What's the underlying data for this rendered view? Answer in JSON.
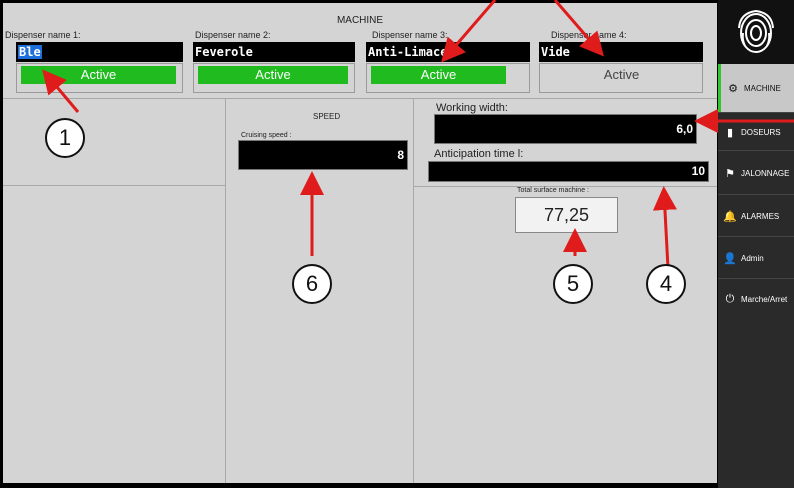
{
  "header": {
    "title": "MACHINE"
  },
  "dispensers": [
    {
      "label": "Dispenser name 1:",
      "name": "Ble",
      "status": "Active"
    },
    {
      "label": "Dispenser name 2:",
      "name": "Feverole",
      "status": "Active"
    },
    {
      "label": "Dispenser name 3:",
      "name": "Anti-Limace",
      "status": "Active"
    },
    {
      "label": "Dispenser name 4:",
      "name": "Vide",
      "status": "Active"
    }
  ],
  "speed": {
    "title": "SPEED",
    "cruising_label": "Cruising speed :",
    "cruising_value": "8"
  },
  "working_width": {
    "label": "Working width:",
    "value": "6,0"
  },
  "anticipation": {
    "label": "Anticipation time l:",
    "value": "10"
  },
  "total": {
    "label": "Total surface machine :",
    "value": "77,25"
  },
  "sidebar": {
    "items": [
      {
        "label": "MACHINE",
        "icon": "gear-icon"
      },
      {
        "label": "DOSEURS",
        "icon": "dispenser-icon"
      },
      {
        "label": "JALONNAGE",
        "icon": "flag-icon"
      },
      {
        "label": "ALARMES",
        "icon": "bell-icon"
      },
      {
        "label": "Admin",
        "icon": "user-icon"
      },
      {
        "label": "Marche/Arret",
        "icon": "power-icon"
      }
    ]
  },
  "callouts": [
    "1",
    "4",
    "5",
    "6"
  ],
  "colors": {
    "active_green": "#1fbb1f",
    "field_black": "#000000",
    "panel_grey": "#d4d4d4",
    "annotation_red": "#e01b1b"
  }
}
